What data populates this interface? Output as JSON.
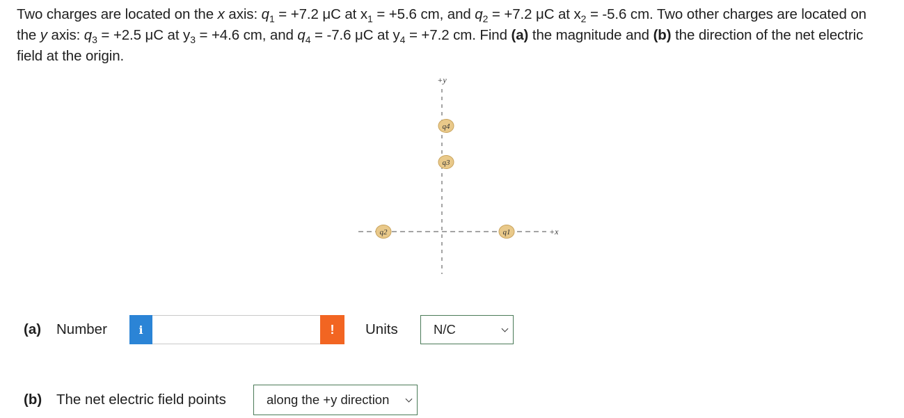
{
  "problem": {
    "s1": "Two charges are located on the ",
    "x_axis_var": "x",
    "s2": " axis: ",
    "q1_sym": "q",
    "q1_sub": "1",
    "q1_val": " = +7.2 μC at x",
    "x1_sub": "1",
    "x1_val": " = +5.6 cm, and ",
    "q2_sym": "q",
    "q2_sub": "2",
    "q2_val": " = +7.2 μC at x",
    "x2_sub": "2",
    "x2_val": " = -5.6 cm. Two other charges are located on the ",
    "y_axis_var": "y",
    "s3": " axis: ",
    "q3_sym": "q",
    "q3_sub": "3",
    "q3_val": " = +2.5 μC at y",
    "y3_sub": "3",
    "y3_val": " = +4.6 cm, and ",
    "q4_sym": "q",
    "q4_sub": "4",
    "q4_val": " = -7.6 μC at y",
    "y4_sub": "4",
    "y4_val": " = +7.2 cm. Find ",
    "a_mark": "(a)",
    "s4": " the magnitude and ",
    "b_mark": "(b)",
    "s5": " the direction of the net electric field at the origin."
  },
  "diagram": {
    "y_axis_label": "+y",
    "x_axis_label": "+x",
    "charges": [
      {
        "label": "q4"
      },
      {
        "label": "q3"
      },
      {
        "label": "q2"
      },
      {
        "label": "q1"
      }
    ],
    "charge_fill": "#e9c98a",
    "charge_stroke": "#c9a35c"
  },
  "part_a": {
    "label": "(a)",
    "field_label": "Number",
    "info_icon_text": "i",
    "value": "",
    "warn_icon_text": "!",
    "units_label": "Units",
    "units_selected": "N/C"
  },
  "part_b": {
    "label": "(b)",
    "field_label": "The net electric field points",
    "direction_selected": "along the +y direction"
  },
  "colors": {
    "info_blue": "#2b84d6",
    "warning_orange": "#f26522",
    "select_border": "#4a7a57"
  }
}
